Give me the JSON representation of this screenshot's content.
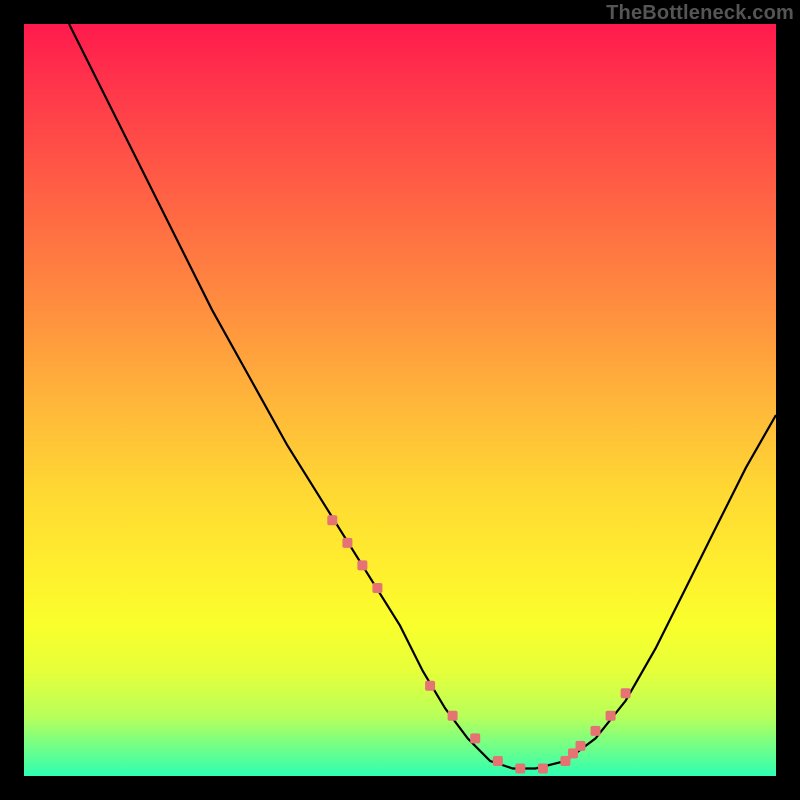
{
  "watermark": "TheBottleneck.com",
  "chart_data": {
    "type": "line",
    "title": "",
    "xlabel": "",
    "ylabel": "",
    "xlim": [
      0,
      100
    ],
    "ylim": [
      0,
      100
    ],
    "series": [
      {
        "name": "bottleneck-curve",
        "x": [
          6,
          10,
          15,
          20,
          25,
          30,
          35,
          40,
          45,
          50,
          53,
          56,
          59,
          62,
          65,
          68,
          72,
          76,
          80,
          84,
          88,
          92,
          96,
          100
        ],
        "values": [
          100,
          92,
          82,
          72,
          62,
          53,
          44,
          36,
          28,
          20,
          14,
          9,
          5,
          2,
          1,
          1,
          2,
          5,
          10,
          17,
          25,
          33,
          41,
          48
        ]
      }
    ],
    "markers": {
      "name": "highlight-dots",
      "x": [
        41,
        43,
        45,
        47,
        54,
        57,
        60,
        63,
        66,
        69,
        72,
        73,
        74,
        76,
        78,
        80
      ],
      "values": [
        34,
        31,
        28,
        25,
        12,
        8,
        5,
        2,
        1,
        1,
        2,
        3,
        4,
        6,
        8,
        11
      ]
    },
    "colors": {
      "curve": "#000000",
      "marker": "#e57373",
      "gradient_top": "#ff1a4d",
      "gradient_bottom": "#2effb2"
    }
  }
}
